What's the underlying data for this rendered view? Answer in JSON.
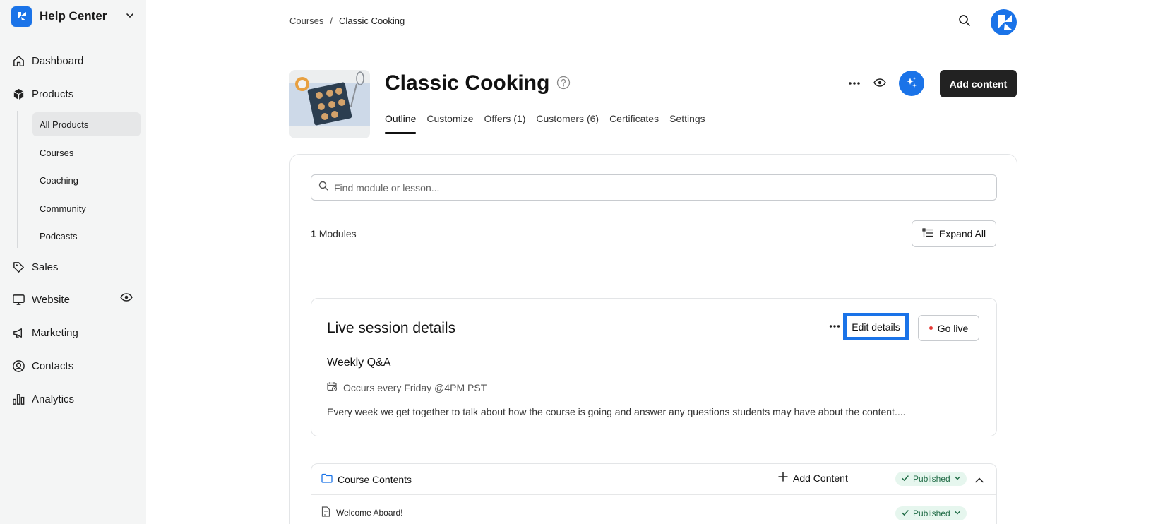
{
  "sidebar": {
    "brand": {
      "title": "Help Center"
    },
    "nav": [
      {
        "label": "Dashboard",
        "icon": "home-icon"
      },
      {
        "label": "Products",
        "icon": "cube-icon"
      },
      {
        "label": "Sales",
        "icon": "tag-icon"
      },
      {
        "label": "Website",
        "icon": "monitor-icon"
      },
      {
        "label": "Marketing",
        "icon": "megaphone-icon"
      },
      {
        "label": "Contacts",
        "icon": "user-circle-icon"
      },
      {
        "label": "Analytics",
        "icon": "bar-chart-icon"
      }
    ],
    "products_sub": [
      {
        "label": "All Products",
        "active": true
      },
      {
        "label": "Courses"
      },
      {
        "label": "Coaching"
      },
      {
        "label": "Community"
      },
      {
        "label": "Podcasts"
      }
    ]
  },
  "breadcrumb": {
    "parent": "Courses",
    "separator": "/",
    "current": "Classic Cooking"
  },
  "header": {
    "title": "Classic Cooking",
    "add_content_label": "Add content",
    "tabs": [
      {
        "label": "Outline",
        "active": true
      },
      {
        "label": "Customize"
      },
      {
        "label": "Offers (1)"
      },
      {
        "label": "Customers (6)"
      },
      {
        "label": "Certificates"
      },
      {
        "label": "Settings"
      }
    ]
  },
  "outline": {
    "search_placeholder": "Find module or lesson...",
    "modules_count": "1",
    "modules_label": "Modules",
    "expand_all_label": "Expand All"
  },
  "live_session": {
    "title": "Live session details",
    "edit_label": "Edit details",
    "go_live_label": "Go live",
    "name": "Weekly Q&A",
    "schedule": "Occurs every Friday @4PM PST",
    "description": "Every week we get together to talk about how the course is going and answer any questions students may have about the content...."
  },
  "course_contents": {
    "title": "Course Contents",
    "add_content_label": "Add Content",
    "status": "Published",
    "lessons": [
      {
        "title": "Welcome Aboard!",
        "status": "Published"
      }
    ]
  },
  "colors": {
    "accent": "#1a73e8",
    "sidebar_bg": "#f4f5f5",
    "published_bg": "#e6f6ee",
    "published_text": "#1f6b45",
    "live_dot": "#e53935"
  }
}
